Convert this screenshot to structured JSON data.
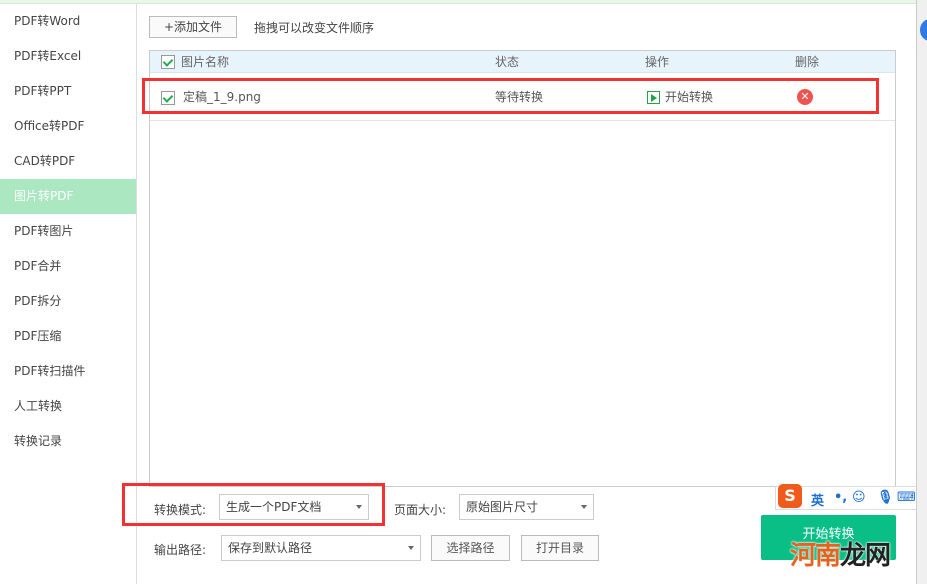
{
  "sidebar": {
    "items": [
      {
        "label": "PDF转Word"
      },
      {
        "label": "PDF转Excel"
      },
      {
        "label": "PDF转PPT"
      },
      {
        "label": "Office转PDF"
      },
      {
        "label": "CAD转PDF"
      },
      {
        "label": "图片转PDF",
        "active": true
      },
      {
        "label": "PDF转图片"
      },
      {
        "label": "PDF合并"
      },
      {
        "label": "PDF拆分"
      },
      {
        "label": "PDF压缩"
      },
      {
        "label": "PDF转扫描件"
      },
      {
        "label": "人工转换"
      },
      {
        "label": "转换记录"
      }
    ]
  },
  "toolbar": {
    "add_file": "+添加文件",
    "hint": "拖拽可以改变文件顺序"
  },
  "table": {
    "headers": {
      "name": "图片名称",
      "status": "状态",
      "action": "操作",
      "delete": "删除"
    },
    "rows": [
      {
        "name": "定稿_1_9.png",
        "status": "等待转换",
        "action": "开始转换",
        "checked": true
      }
    ]
  },
  "options": {
    "mode_label": "转换模式:",
    "mode_value": "生成一个PDF文档",
    "page_size_label": "页面大小:",
    "page_size_value": "原始图片尺寸",
    "output_label": "输出路径:",
    "output_value": "保存到默认路径",
    "choose_path": "选择路径",
    "open_dir": "打开目录"
  },
  "start_button": "开始转换",
  "ime": {
    "lang": "英",
    "punct": "•,"
  },
  "watermark": {
    "part1": "河南",
    "part2": "龙网"
  },
  "colors": {
    "accent": "#0abf86",
    "active_sidebar": "#abe8c2",
    "highlight": "#f03232"
  }
}
